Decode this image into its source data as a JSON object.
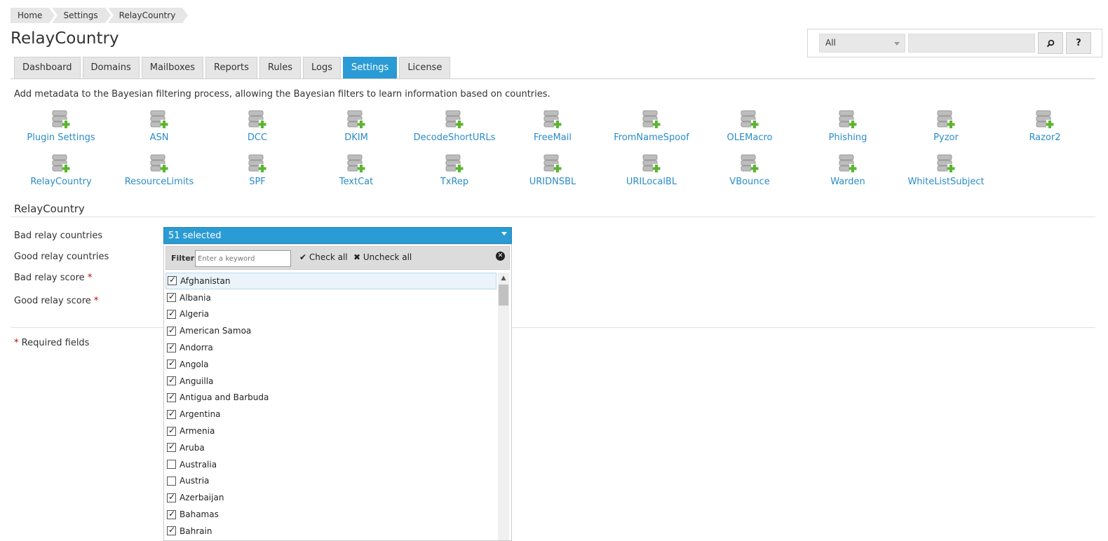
{
  "breadcrumb": [
    "Home",
    "Settings",
    "RelayCountry"
  ],
  "page_title": "RelayCountry",
  "search": {
    "scope": "All",
    "value": "",
    "search_icon": "magnifier-icon",
    "help_label": "?"
  },
  "tabs": [
    {
      "label": "Dashboard",
      "active": false
    },
    {
      "label": "Domains",
      "active": false
    },
    {
      "label": "Mailboxes",
      "active": false
    },
    {
      "label": "Reports",
      "active": false
    },
    {
      "label": "Rules",
      "active": false
    },
    {
      "label": "Logs",
      "active": false
    },
    {
      "label": "Settings",
      "active": true
    },
    {
      "label": "License",
      "active": false
    }
  ],
  "description": "Add metadata to the Bayesian filtering process, allowing the Bayesian filters to learn information based on countries.",
  "plugins": [
    "Plugin Settings",
    "ASN",
    "DCC",
    "DKIM",
    "DecodeShortURLs",
    "FreeMail",
    "FromNameSpoof",
    "OLEMacro",
    "Phishing",
    "Pyzor",
    "Razor2",
    "RelayCountry",
    "ResourceLimits",
    "SPF",
    "TextCat",
    "TxRep",
    "URIDNSBL",
    "URILocalBL",
    "VBounce",
    "Warden",
    "WhiteListSubject"
  ],
  "section_title": "RelayCountry",
  "form": {
    "bad_countries_label": "Bad relay countries",
    "good_countries_label": "Good relay countries",
    "bad_score_label": "Bad relay score",
    "good_score_label": "Good relay score",
    "required_marker": "*",
    "required_note": "Required fields"
  },
  "multiselect": {
    "selected_text": "51 selected",
    "filter_label": "Filter:",
    "filter_placeholder": "Enter a keyword",
    "check_all": "Check all",
    "uncheck_all": "Uncheck all",
    "check_icon": "✔",
    "uncheck_icon": "✖",
    "close_icon": "✕",
    "items": [
      {
        "label": "Afghanistan",
        "checked": true
      },
      {
        "label": "Albania",
        "checked": true
      },
      {
        "label": "Algeria",
        "checked": true
      },
      {
        "label": "American Samoa",
        "checked": true
      },
      {
        "label": "Andorra",
        "checked": true
      },
      {
        "label": "Angola",
        "checked": true
      },
      {
        "label": "Anguilla",
        "checked": true
      },
      {
        "label": "Antigua and Barbuda",
        "checked": true
      },
      {
        "label": "Argentina",
        "checked": true
      },
      {
        "label": "Armenia",
        "checked": true
      },
      {
        "label": "Aruba",
        "checked": true
      },
      {
        "label": "Australia",
        "checked": false
      },
      {
        "label": "Austria",
        "checked": false
      },
      {
        "label": "Azerbaijan",
        "checked": true
      },
      {
        "label": "Bahamas",
        "checked": true
      },
      {
        "label": "Bahrain",
        "checked": true
      }
    ]
  },
  "colors": {
    "accent": "#2a9bd4",
    "link": "#2a8cc8",
    "required": "#cc0000",
    "tab_bg": "#e6e6e6"
  }
}
